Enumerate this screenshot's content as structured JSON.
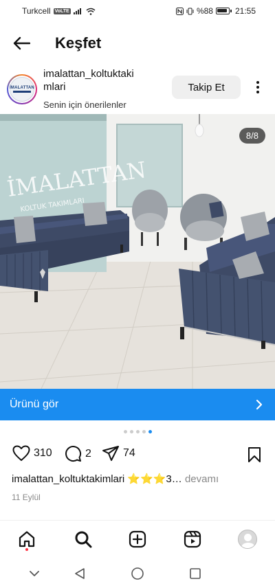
{
  "status_bar": {
    "carrier": "Turkcell",
    "network_badge": "VoLTE",
    "battery": "%88",
    "time": "21:55"
  },
  "header": {
    "title": "Keşfet"
  },
  "post": {
    "username_line1": "imalattan_koltuktaki",
    "username_line2": "mlari",
    "subtitle": "Senin için önerilenler",
    "follow_label": "Takip Et",
    "avatar_text": "İMALATTAN",
    "image_counter": "8/8",
    "cta_label": "Ürünü gör",
    "carousel_index": 5,
    "carousel_count": 5,
    "likes": "310",
    "comments": "2",
    "shares": "74",
    "caption_user": "imalattan_koltuktakimlari",
    "caption_text": "⭐⭐⭐3…",
    "caption_more": "devamı",
    "date": "11 Eylül"
  },
  "wall_sign": {
    "line1": "İMALATTAN",
    "line2": "KOLTUK TAKIMLARI"
  },
  "colors": {
    "accent": "#1a8cf0",
    "sofa": "#3f4b66",
    "pillow": "#a9adb2"
  }
}
